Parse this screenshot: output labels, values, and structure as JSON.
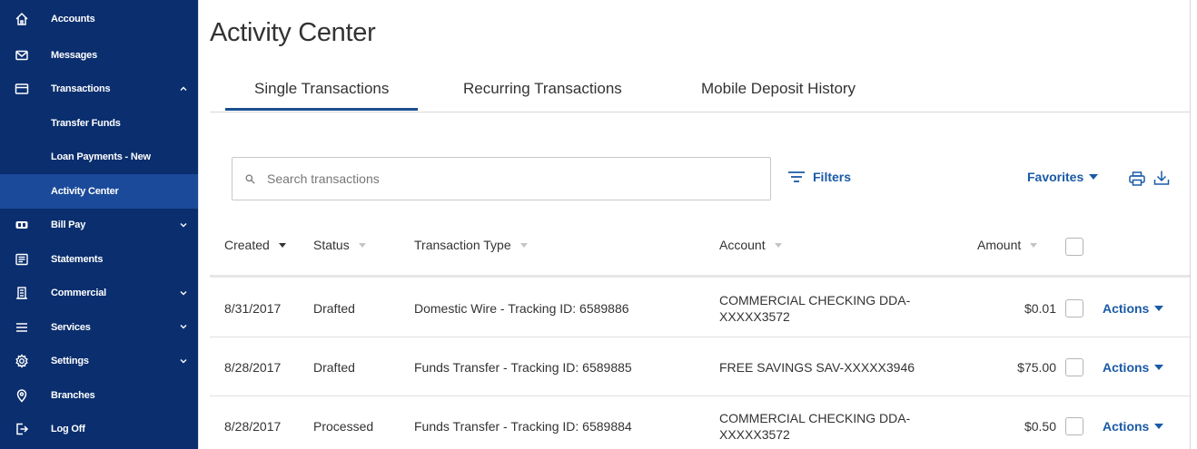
{
  "sidebar": {
    "items": [
      {
        "label": "Accounts",
        "icon": "home-icon"
      },
      {
        "label": "Messages",
        "icon": "envelope-icon"
      },
      {
        "label": "Transactions",
        "icon": "card-icon"
      },
      {
        "label": "Transfer Funds"
      },
      {
        "label": "Loan Payments - New"
      },
      {
        "label": "Activity Center"
      },
      {
        "label": "Bill Pay",
        "icon": "bill-icon"
      },
      {
        "label": "Statements",
        "icon": "statements-icon"
      },
      {
        "label": "Commercial",
        "icon": "building-icon"
      },
      {
        "label": "Services",
        "icon": "menu-icon"
      },
      {
        "label": "Settings",
        "icon": "gear-icon"
      },
      {
        "label": "Branches",
        "icon": "location-pin-icon"
      },
      {
        "label": "Log Off",
        "icon": "logout-icon"
      }
    ]
  },
  "page_title": "Activity Center",
  "tabs": [
    {
      "label": "Single Transactions"
    },
    {
      "label": "Recurring Transactions"
    },
    {
      "label": "Mobile Deposit History"
    }
  ],
  "search": {
    "placeholder": "Search transactions"
  },
  "toolbar": {
    "filters_label": "Filters",
    "favorites_label": "Favorites"
  },
  "columns": {
    "created": "Created",
    "status": "Status",
    "type": "Transaction Type",
    "account": "Account",
    "amount": "Amount"
  },
  "rows": [
    {
      "created": "8/31/2017",
      "status": "Drafted",
      "type": "Domestic Wire - Tracking ID: 6589886",
      "account": "COMMERCIAL CHECKING DDA-XXXXX3572",
      "amount": "$0.01",
      "actions": "Actions"
    },
    {
      "created": "8/28/2017",
      "status": "Drafted",
      "type": "Funds Transfer - Tracking ID: 6589885",
      "account": "FREE SAVINGS SAV-XXXXX3946",
      "amount": "$75.00",
      "actions": "Actions"
    },
    {
      "created": "8/28/2017",
      "status": "Processed",
      "type": "Funds Transfer - Tracking ID: 6589884",
      "account": "COMMERCIAL CHECKING DDA-XXXXX3572",
      "amount": "$0.50",
      "actions": "Actions"
    }
  ],
  "colors": {
    "sidebar_bg": "#0a2e6e",
    "sidebar_active": "#1b4a9a",
    "accent": "#1a5aa6",
    "tab_underline": "#1a4f91"
  }
}
